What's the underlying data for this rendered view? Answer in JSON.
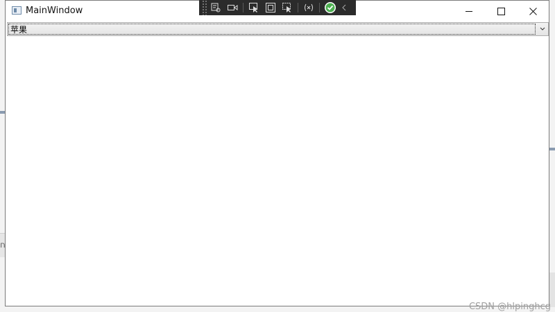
{
  "window": {
    "title": "MainWindow"
  },
  "combobox": {
    "selected": "苹果"
  },
  "watermark": "CSDN @hlpinghcg",
  "background": {
    "partial_text": "ח"
  },
  "colors": {
    "toolbar_bg": "#2b2b2b",
    "window_border": "#7a7a7a",
    "check_green": "#4caf50"
  }
}
